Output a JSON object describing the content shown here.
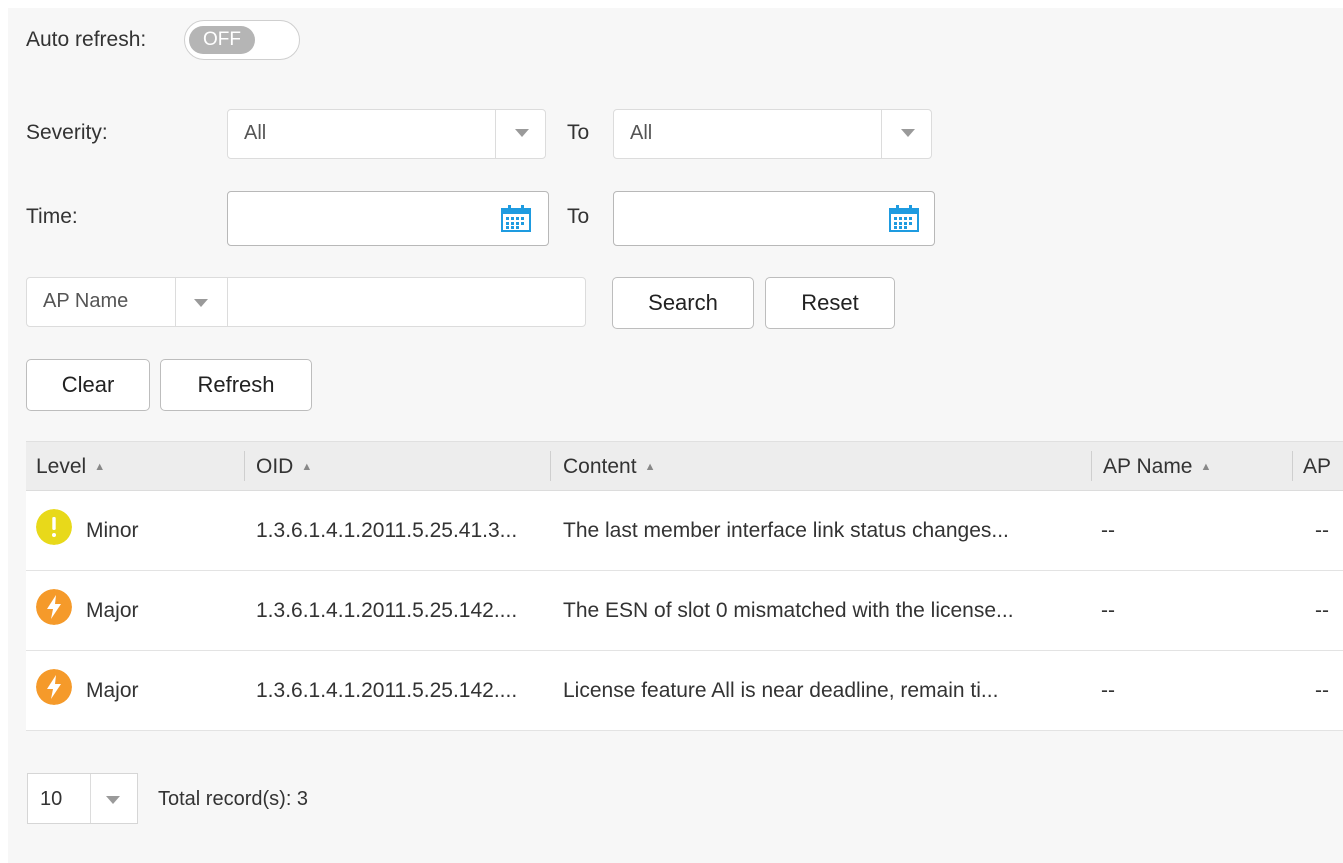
{
  "auto_refresh": {
    "label": "Auto refresh:",
    "state": "OFF"
  },
  "filters": {
    "severity_label": "Severity:",
    "severity_from": "All",
    "severity_to": "All",
    "to_label": "To",
    "time_label": "Time:",
    "time_from": "",
    "time_to": "",
    "field_select": "AP Name",
    "field_value": "",
    "search_button": "Search",
    "reset_button": "Reset"
  },
  "actions": {
    "clear_button": "Clear",
    "refresh_button": "Refresh"
  },
  "table": {
    "columns": [
      {
        "label": "Level"
      },
      {
        "label": "OID"
      },
      {
        "label": "Content"
      },
      {
        "label": "AP Name"
      },
      {
        "label": "AP"
      }
    ],
    "rows": [
      {
        "level": "Minor",
        "icon": "exclamation-icon",
        "oid": "1.3.6.1.4.1.2011.5.25.41.3...",
        "content": "The last member interface link status changes...",
        "ap_name": "--",
        "ap": "--"
      },
      {
        "level": "Major",
        "icon": "lightning-icon",
        "oid": "1.3.6.1.4.1.2011.5.25.142....",
        "content": "The ESN of slot 0 mismatched with the license...",
        "ap_name": "--",
        "ap": "--"
      },
      {
        "level": "Major",
        "icon": "lightning-icon",
        "oid": "1.3.6.1.4.1.2011.5.25.142....",
        "content": "License feature All is near deadline, remain ti...",
        "ap_name": "--",
        "ap": "--"
      }
    ]
  },
  "pager": {
    "page_size": "10",
    "total": "Total record(s): 3"
  },
  "colors": {
    "minor": "#e8d91a",
    "major": "#f59a2a",
    "calendar": "#1e9be0"
  }
}
